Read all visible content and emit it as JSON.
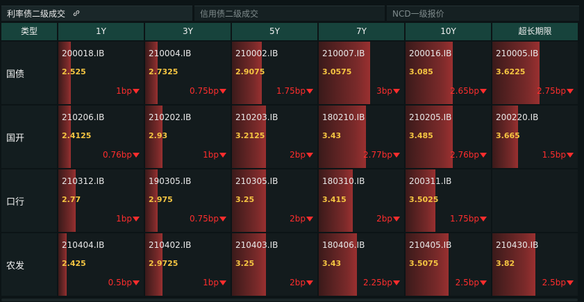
{
  "tabs": [
    {
      "label": "利率债二级成交",
      "active": true
    },
    {
      "label": "信用债二级成交",
      "active": false
    },
    {
      "label": "NCD一级报价",
      "active": false
    }
  ],
  "table": {
    "header_type": "类型",
    "columns": [
      "1Y",
      "3Y",
      "5Y",
      "7Y",
      "10Y",
      "超长期限"
    ],
    "rows": [
      {
        "label": "国债",
        "cells": [
          {
            "code": "200018.IB",
            "yield": "2.525",
            "change": "1bp",
            "intensity": 0.15
          },
          {
            "code": "210004.IB",
            "yield": "2.7325",
            "change": "0.75bp",
            "intensity": 0.15
          },
          {
            "code": "210002.IB",
            "yield": "2.9075",
            "change": "1.75bp",
            "intensity": 0.35
          },
          {
            "code": "210007.IB",
            "yield": "3.0575",
            "change": "3bp",
            "intensity": 0.6
          },
          {
            "code": "200016.IB",
            "yield": "3.085",
            "change": "2.65bp",
            "intensity": 0.55
          },
          {
            "code": "210005.IB",
            "yield": "3.6225",
            "change": "2.75bp",
            "intensity": 0.55
          }
        ]
      },
      {
        "label": "国开",
        "cells": [
          {
            "code": "210206.IB",
            "yield": "2.4125",
            "change": "0.76bp",
            "intensity": 0.15
          },
          {
            "code": "210202.IB",
            "yield": "2.93",
            "change": "1bp",
            "intensity": 0.2
          },
          {
            "code": "210203.IB",
            "yield": "3.2125",
            "change": "2bp",
            "intensity": 0.4
          },
          {
            "code": "180210.IB",
            "yield": "3.43",
            "change": "2.77bp",
            "intensity": 0.55
          },
          {
            "code": "210205.IB",
            "yield": "3.485",
            "change": "2.76bp",
            "intensity": 0.55
          },
          {
            "code": "200220.IB",
            "yield": "3.665",
            "change": "1.5bp",
            "intensity": 0.3
          }
        ]
      },
      {
        "label": "口行",
        "cells": [
          {
            "code": "210312.IB",
            "yield": "2.77",
            "change": "1bp",
            "intensity": 0.2
          },
          {
            "code": "190305.IB",
            "yield": "2.975",
            "change": "0.75bp",
            "intensity": 0.15
          },
          {
            "code": "210305.IB",
            "yield": "3.25",
            "change": "2bp",
            "intensity": 0.4
          },
          {
            "code": "180310.IB",
            "yield": "3.415",
            "change": "2bp",
            "intensity": 0.4
          },
          {
            "code": "200311.IB",
            "yield": "3.5025",
            "change": "1.75bp",
            "intensity": 0.35
          },
          {
            "code": "",
            "yield": "",
            "change": "",
            "intensity": 0
          }
        ]
      },
      {
        "label": "农发",
        "cells": [
          {
            "code": "210404.IB",
            "yield": "2.425",
            "change": "0.5bp",
            "intensity": 0.1
          },
          {
            "code": "210402.IB",
            "yield": "2.9725",
            "change": "1bp",
            "intensity": 0.2
          },
          {
            "code": "210403.IB",
            "yield": "3.25",
            "change": "2bp",
            "intensity": 0.4
          },
          {
            "code": "180406.IB",
            "yield": "3.43",
            "change": "2.25bp",
            "intensity": 0.45
          },
          {
            "code": "210405.IB",
            "yield": "3.5075",
            "change": "2.5bp",
            "intensity": 0.5
          },
          {
            "code": "210430.IB",
            "yield": "3.82",
            "change": "2.5bp",
            "intensity": 0.5
          }
        ]
      }
    ]
  },
  "colors": {
    "header_bg": "#17433c",
    "yield_text": "#f5c542",
    "change_down": "#ff2d2d"
  },
  "icons": {
    "tab_link": "link-icon",
    "change_arrow": "down-triangle-icon"
  }
}
